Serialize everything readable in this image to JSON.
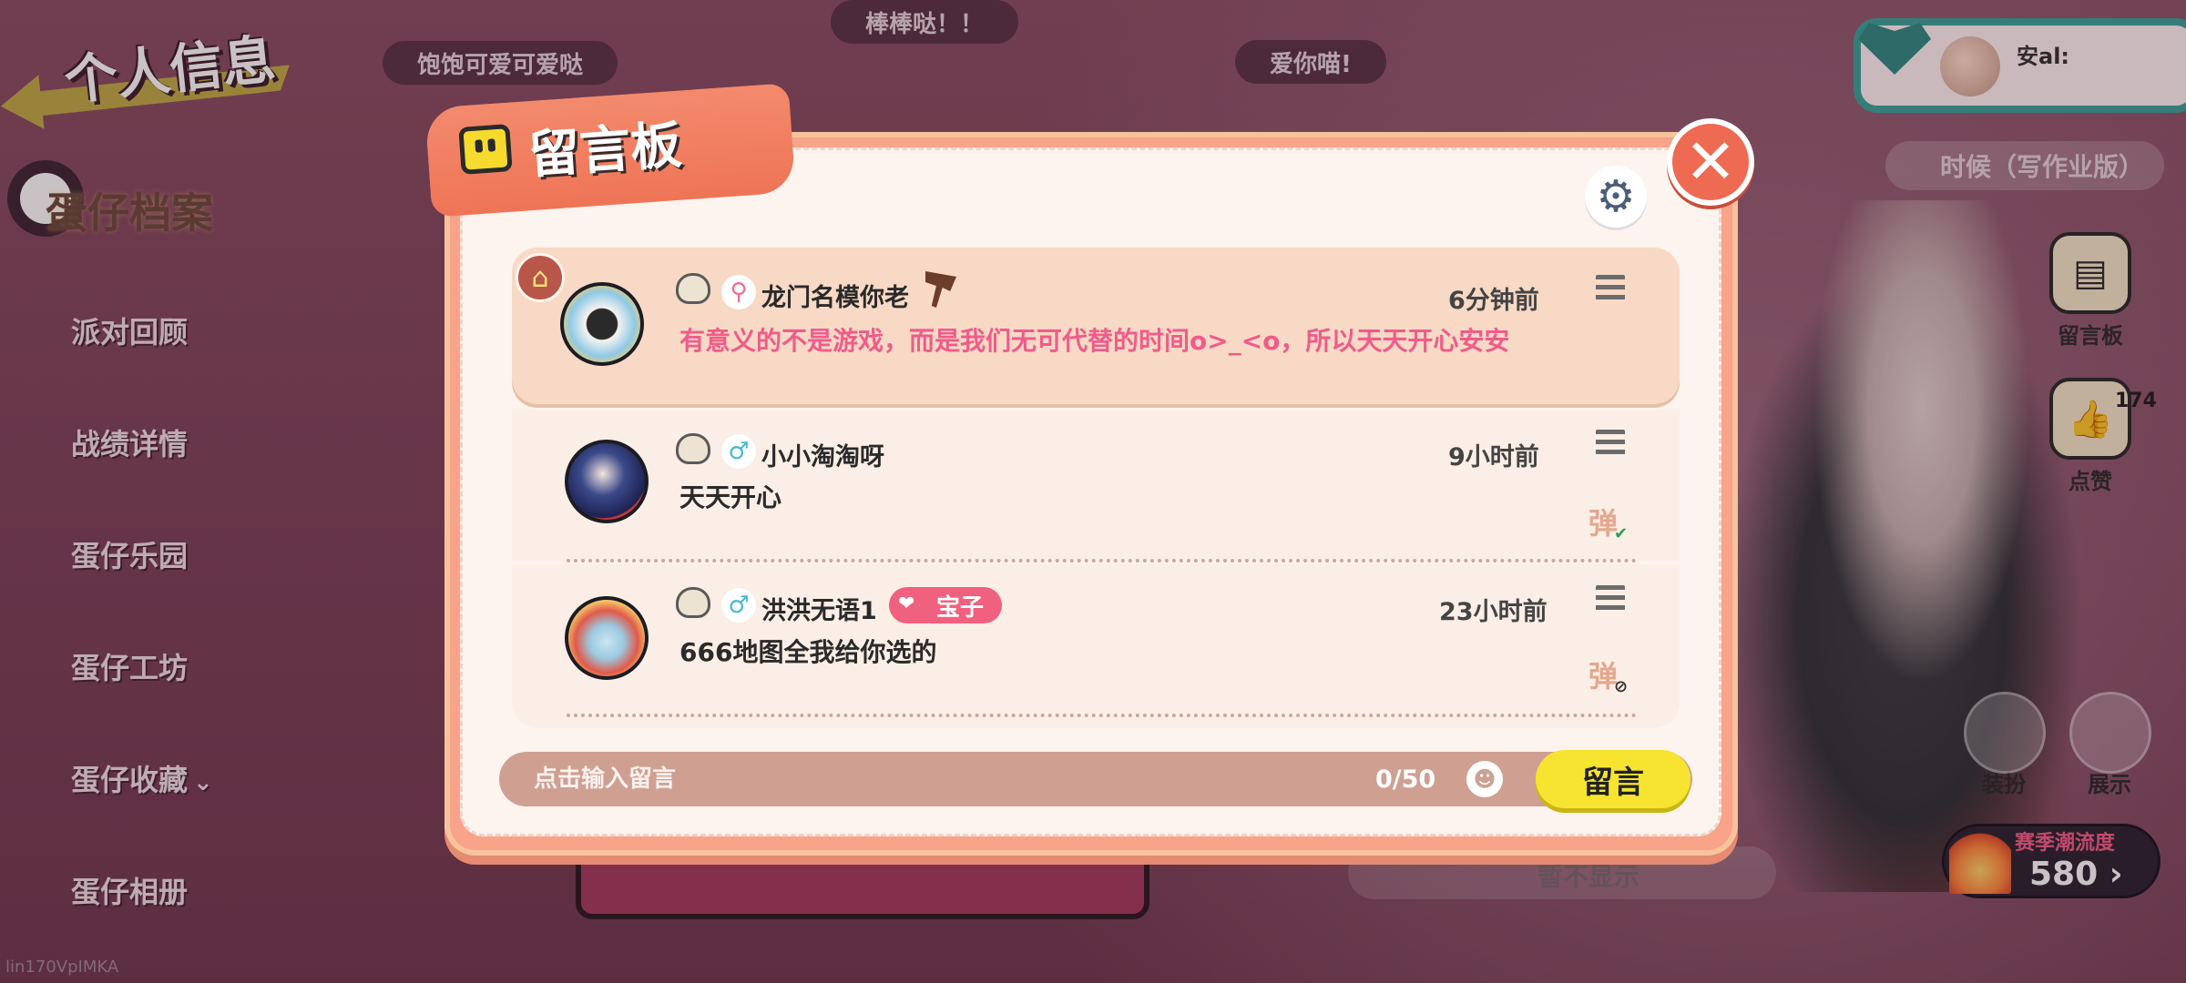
{
  "background": {
    "page_title": "个人信息",
    "sidebar": {
      "section_title": "蛋仔档案",
      "items": [
        "派对回顾",
        "战绩详情",
        "蛋仔乐园",
        "蛋仔工坊",
        "蛋仔收藏",
        "蛋仔相册"
      ]
    },
    "pills": [
      "饱饱可爱可爱哒",
      "棒棒哒！！",
      "爱你喵!"
    ],
    "user": {
      "name": "安al:"
    },
    "time_chip": "时候（写作业版）",
    "right_buttons": {
      "board": "留言板",
      "like": "点赞",
      "like_count": "174",
      "dressup": "装扮",
      "showcase": "展示"
    },
    "season": {
      "title": "赛季潮流度",
      "value": "580",
      "arrow": "›"
    },
    "hidden_row_text": "暂不显示",
    "bottom_tag": "lin170VpIMKA"
  },
  "dialog": {
    "title": "留言板",
    "close_glyph": "✕",
    "gear_glyph": "⚙",
    "messages": [
      {
        "name": "龙门名模你老",
        "time": "6分钟前",
        "text": "有意义的不是游戏，而是我们无可代替的时间o>_<o，所以天天开心安安",
        "gender": "female",
        "highlighted": true
      },
      {
        "name": "小小淘淘呀",
        "time": "9小时前",
        "text": "天天开心",
        "gender": "male",
        "danmaku": "弹"
      },
      {
        "name": "洪洪无语1",
        "time": "23小时前",
        "text": "666地图全我给你选的",
        "gender": "male",
        "tag": "宝子",
        "danmaku": "弹"
      }
    ],
    "input": {
      "placeholder": "点击输入留言",
      "counter": "0/50"
    },
    "send_label": "留言"
  },
  "colors": {
    "dialog_frame": "#f8a38a",
    "highlight_row": "#f7d9c5",
    "pink_text": "#ef5c8a",
    "send_button": "#f6e430",
    "close_button": "#ef6a52"
  },
  "icons": {
    "gender_male": "♂",
    "gender_female": "⚲",
    "home": "⌂",
    "heart": "❤",
    "emoji": "☻",
    "check": "✔",
    "block": "⊘",
    "chevron": "⌄"
  }
}
